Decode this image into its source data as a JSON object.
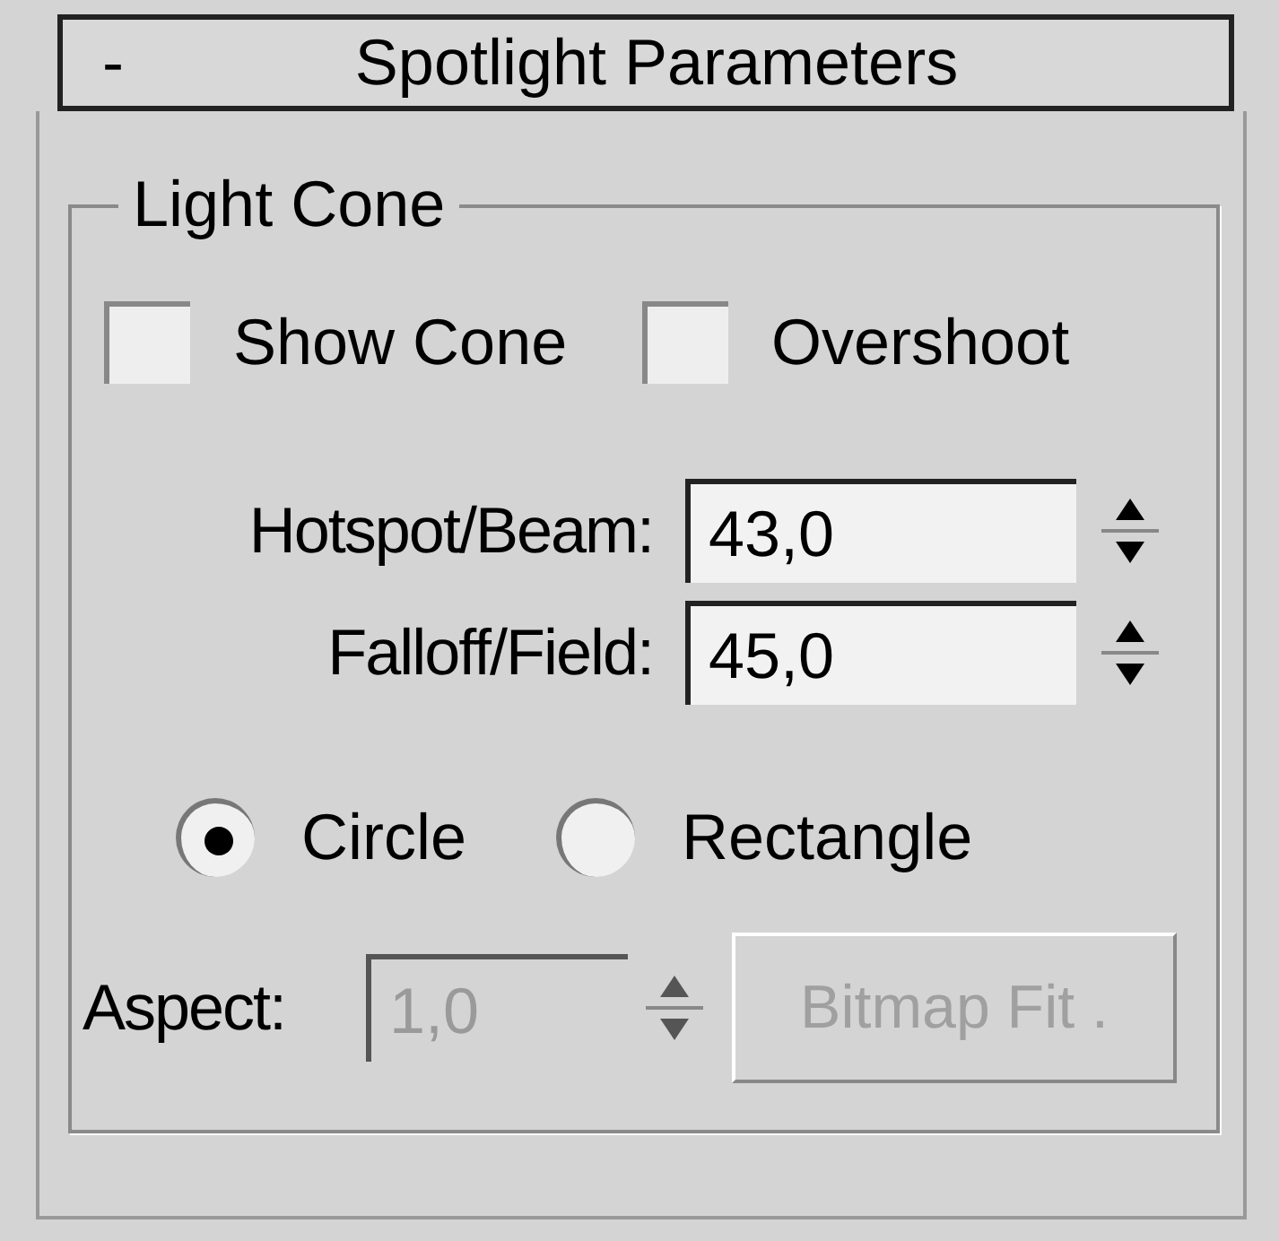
{
  "rollout": {
    "collapse_icon": "-",
    "title": "Spotlight Parameters"
  },
  "group": {
    "title": "Light Cone"
  },
  "checkboxes": [
    {
      "label": "Show Cone",
      "checked": false
    },
    {
      "label": "Overshoot",
      "checked": false
    }
  ],
  "spinners": [
    {
      "label": "Hotspot/Beam:",
      "value": "43,0"
    },
    {
      "label": "Falloff/Field:",
      "value": "45,0"
    }
  ],
  "radios": [
    {
      "label": "Circle",
      "selected": true
    },
    {
      "label": "Rectangle",
      "selected": false
    }
  ],
  "aspect": {
    "label": "Aspect:",
    "value": "1,0",
    "disabled": true
  },
  "bitmap_fit": {
    "label": "Bitmap Fit .",
    "disabled": true
  }
}
